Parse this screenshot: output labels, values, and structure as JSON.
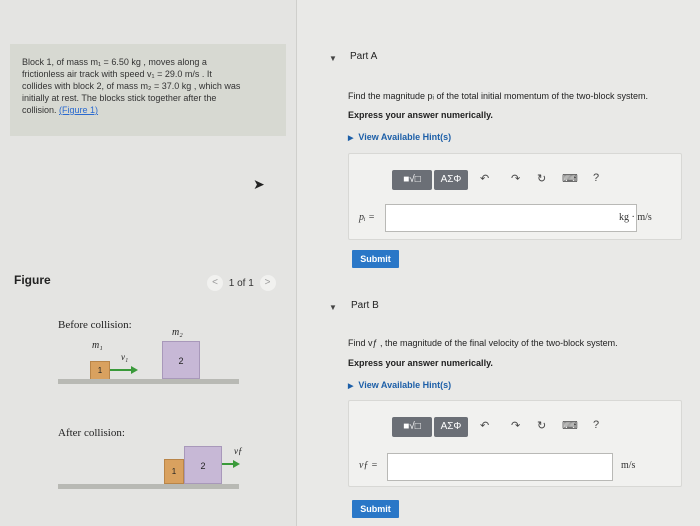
{
  "problem": {
    "line1": "Block 1, of mass m₁ = 6.50 kg , moves along a",
    "line2": "frictionless air track with speed v₁ = 29.0 m/s . It",
    "line3": "collides with block 2, of mass m₂ = 37.0 kg , which was",
    "line4": "initially at rest. The blocks stick together after the",
    "line5_prefix": "collision. ",
    "figure_link": "(Figure 1)"
  },
  "figure": {
    "label": "Figure",
    "pager_text": "1 of 1",
    "prev": "<",
    "next": ">",
    "before_label": "Before collision:",
    "after_label": "After collision:",
    "m1": "m₁",
    "m2": "m₂",
    "v1": "v₁",
    "vf": "vƒ",
    "block1": "1",
    "block2": "2"
  },
  "partA": {
    "title": "Part A",
    "question": "Find the magnitude pᵢ of the total initial momentum of the two-block system.",
    "instruction": "Express your answer numerically.",
    "hint": "View Available Hint(s)",
    "var": "pᵢ =",
    "unit": "kg · m/s",
    "submit": "Submit"
  },
  "partB": {
    "title": "Part B",
    "question": "Find vƒ , the magnitude of the final velocity of the two-block system.",
    "instruction": "Express your answer numerically.",
    "hint": "View Available Hint(s)",
    "var": "vƒ =",
    "unit": "m/s",
    "submit": "Submit"
  },
  "toolbar": {
    "templates": "■√□",
    "greek": "AΣΦ",
    "undo": "↶",
    "redo": "↷",
    "reset": "↻",
    "keyboard": "⌨",
    "help": "?"
  },
  "icons": {
    "caret": "▼",
    "hint_arrow": "▶"
  }
}
